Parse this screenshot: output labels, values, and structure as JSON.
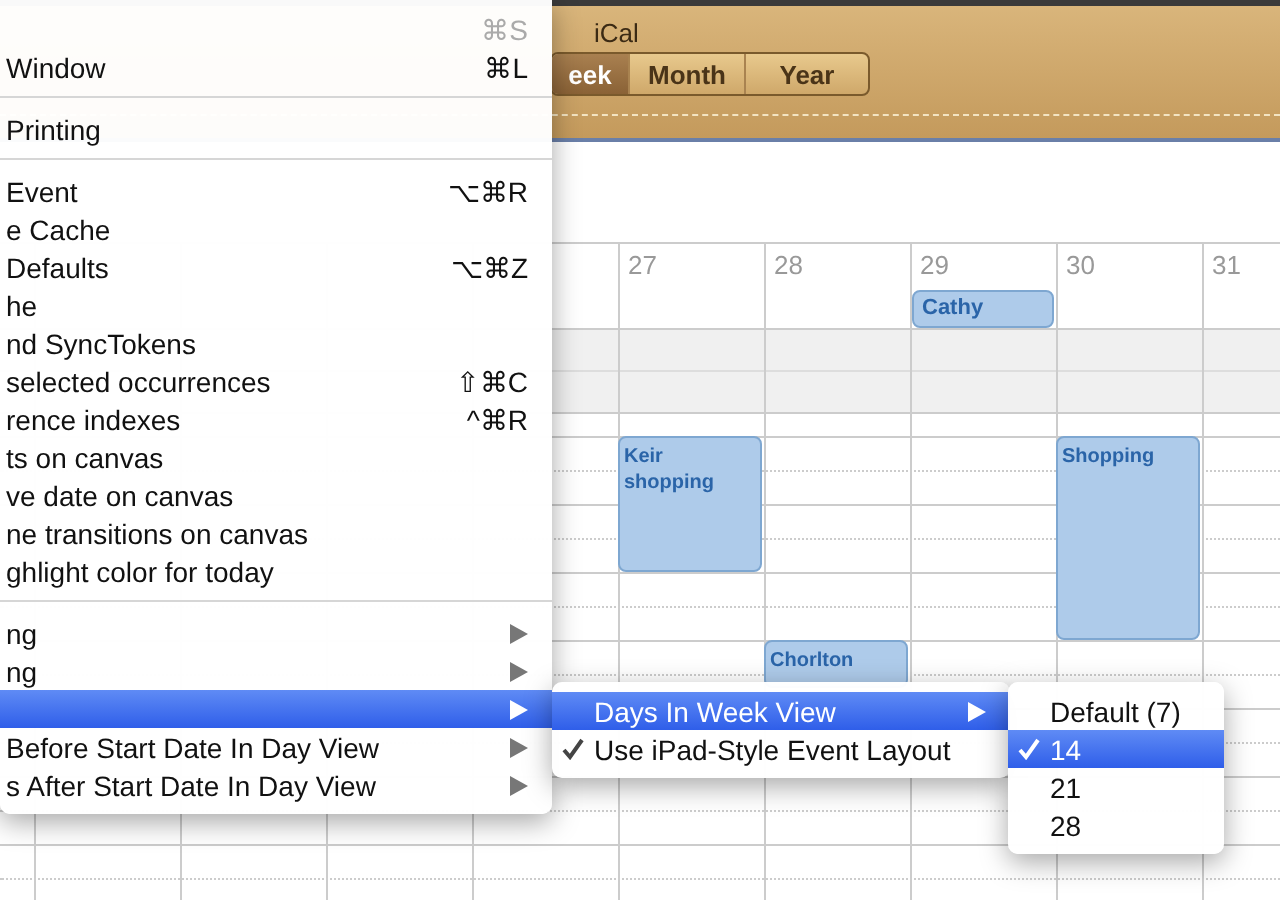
{
  "window": {
    "title": "iCal"
  },
  "view_switcher": [
    {
      "label": "eek",
      "selected": true
    },
    {
      "label": "Month",
      "selected": false
    },
    {
      "label": "Year",
      "selected": false
    }
  ],
  "calendar": {
    "days": [
      {
        "label": "27",
        "events": [
          {
            "title": "Keir shopping",
            "kind": "timed"
          }
        ]
      },
      {
        "label": "28",
        "events": [
          {
            "title": "Chorlton",
            "kind": "timed"
          }
        ]
      },
      {
        "label": "29",
        "events": [
          {
            "title": "Cathy",
            "kind": "all-day"
          }
        ]
      },
      {
        "label": "30",
        "events": [
          {
            "title": "Shopping",
            "kind": "timed"
          }
        ]
      },
      {
        "label": "31"
      }
    ]
  },
  "menus": [
    {
      "items": [
        {
          "kind": "item",
          "shortcut": "⌘S",
          "disabled": true,
          "selected": false,
          "submenu": false
        },
        {
          "kind": "item",
          "label": "Window",
          "shortcut": "⌘L",
          "disabled": false,
          "selected": false,
          "submenu": false
        },
        {
          "kind": "separator"
        },
        {
          "kind": "item",
          "label": "Printing",
          "disabled": false,
          "selected": false,
          "submenu": false
        },
        {
          "kind": "separator"
        },
        {
          "kind": "item",
          "label": "Event",
          "shortcut": "⌥⌘R",
          "disabled": false,
          "selected": false,
          "submenu": false
        },
        {
          "kind": "item",
          "label": "e Cache",
          "disabled": false,
          "selected": false,
          "submenu": false
        },
        {
          "kind": "item",
          "label": "Defaults",
          "shortcut": "⌥⌘Z",
          "disabled": false,
          "selected": false,
          "submenu": false
        },
        {
          "kind": "item",
          "label": "he",
          "disabled": false,
          "selected": false,
          "submenu": false
        },
        {
          "kind": "item",
          "label": "nd SyncTokens",
          "disabled": false,
          "selected": false,
          "submenu": false
        },
        {
          "kind": "item",
          "label": "selected occurrences",
          "shortcut": "⇧⌘C",
          "disabled": false,
          "selected": false,
          "submenu": false
        },
        {
          "kind": "item",
          "label": "rence indexes",
          "shortcut": "^⌘R",
          "disabled": false,
          "selected": false,
          "submenu": false
        },
        {
          "kind": "item",
          "label": "ts on canvas",
          "disabled": false,
          "selected": false,
          "submenu": false
        },
        {
          "kind": "item",
          "label": "ve date on canvas",
          "disabled": false,
          "selected": false,
          "submenu": false
        },
        {
          "kind": "item",
          "label": "ne transitions on canvas",
          "disabled": false,
          "selected": false,
          "submenu": false
        },
        {
          "kind": "item",
          "label": "ghlight color for today",
          "disabled": false,
          "selected": false,
          "submenu": false
        },
        {
          "kind": "separator"
        },
        {
          "kind": "item",
          "label": "ng",
          "disabled": false,
          "selected": false,
          "submenu": true
        },
        {
          "kind": "item",
          "label": "ng",
          "disabled": false,
          "selected": false,
          "submenu": true
        },
        {
          "kind": "item",
          "disabled": false,
          "selected": true,
          "submenu": true
        },
        {
          "kind": "item",
          "label": "Before Start Date In Day View",
          "disabled": false,
          "selected": false,
          "submenu": true
        },
        {
          "kind": "item",
          "label": "s After Start Date In Day View",
          "disabled": false,
          "selected": false,
          "submenu": true
        }
      ]
    },
    {
      "items": [
        {
          "kind": "item",
          "label": "Days In Week View",
          "disabled": false,
          "selected": true,
          "checked": false,
          "submenu": true
        },
        {
          "kind": "item",
          "label": "Use iPad-Style Event Layout",
          "disabled": false,
          "selected": false,
          "checked": true,
          "submenu": false
        }
      ]
    },
    {
      "items": [
        {
          "kind": "item",
          "label": "Default (7)",
          "disabled": false,
          "selected": false,
          "checked": false,
          "submenu": false
        },
        {
          "kind": "item",
          "label": "14",
          "disabled": false,
          "selected": true,
          "checked": true,
          "submenu": false
        },
        {
          "kind": "item",
          "label": "21",
          "disabled": false,
          "selected": false,
          "checked": false,
          "submenu": false
        },
        {
          "kind": "item",
          "label": "28",
          "disabled": false,
          "selected": false,
          "checked": false,
          "submenu": false
        }
      ]
    }
  ]
}
